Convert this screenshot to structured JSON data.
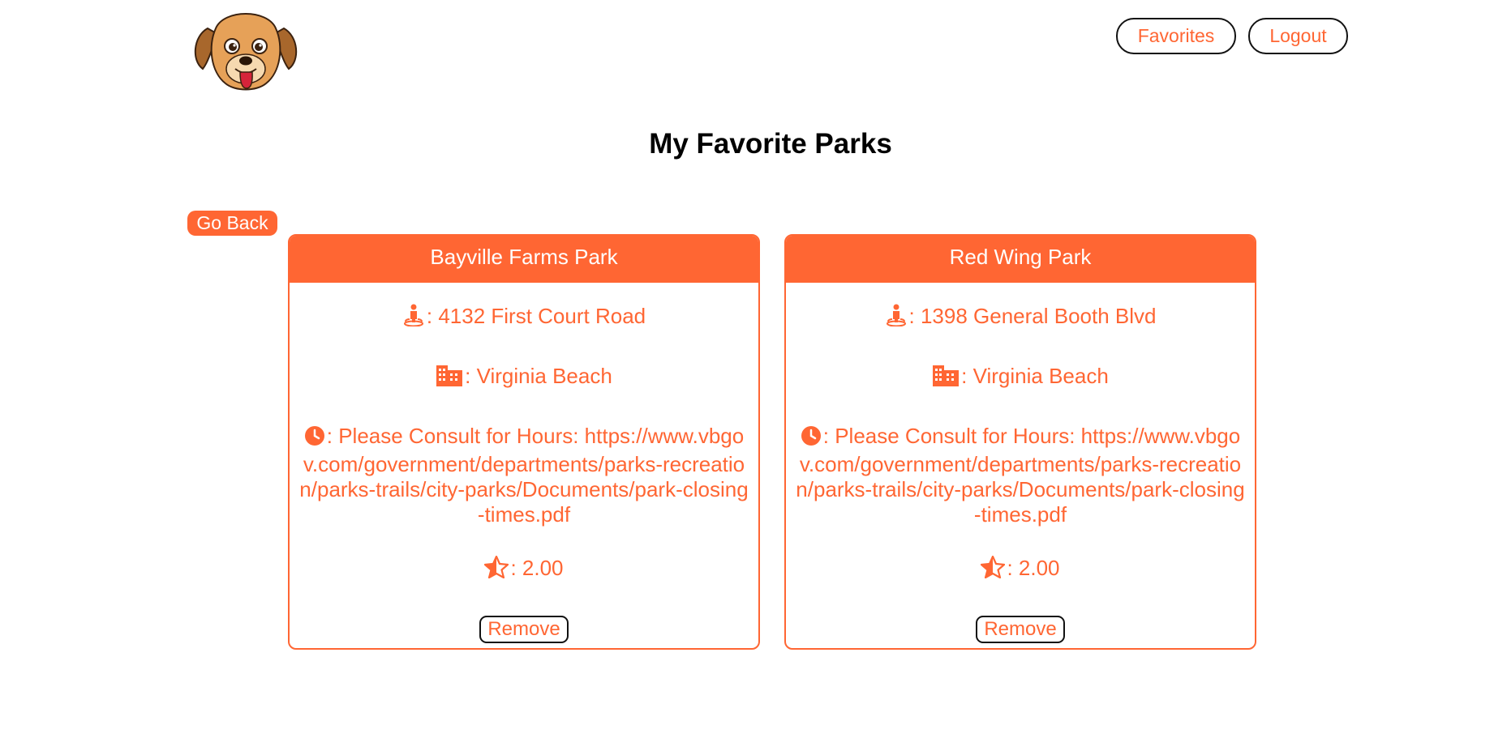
{
  "header": {
    "logo_icon": "dog-mascot-logo",
    "nav": {
      "favorites_label": "Favorites",
      "logout_label": "Logout"
    }
  },
  "main": {
    "title": "My Favorite Parks",
    "go_back_label": "Go Back",
    "parks": [
      {
        "name": "Bayville Farms Park",
        "address": ": 4132 First Court Road",
        "city": ": Virginia Beach",
        "hours": ": Please Consult for Hours: https://www.vbgov.com/government/departments/parks-recreation/parks-trails/city-parks/Documents/park-closing-times.pdf",
        "rating": ": 2.00",
        "remove_label": "Remove"
      },
      {
        "name": "Red Wing Park",
        "address": ": 1398 General Booth Blvd",
        "city": ": Virginia Beach",
        "hours": ": Please Consult for Hours: https://www.vbgov.com/government/departments/parks-recreation/parks-trails/city-parks/Documents/park-closing-times.pdf",
        "rating": ": 2.00",
        "remove_label": "Remove"
      }
    ]
  },
  "icons": {
    "address": "person-location-icon",
    "city": "city-buildings-icon",
    "hours": "clock-icon",
    "rating": "half-star-icon"
  },
  "colors": {
    "accent": "#ff6633",
    "text": "#000000",
    "border_dark": "#111111"
  }
}
